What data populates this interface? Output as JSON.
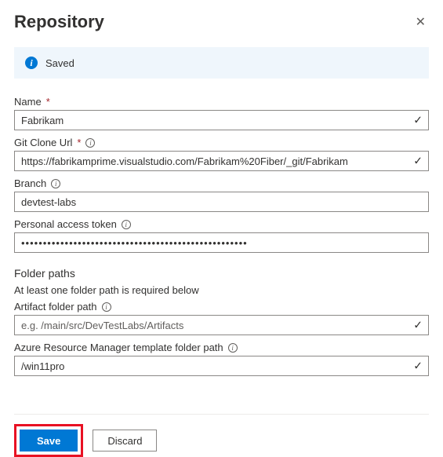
{
  "header": {
    "title": "Repository"
  },
  "status": {
    "text": "Saved"
  },
  "fields": {
    "name": {
      "label": "Name",
      "value": "Fabrikam"
    },
    "gitCloneUrl": {
      "label": "Git Clone Url",
      "value": "https://fabrikamprime.visualstudio.com/Fabrikam%20Fiber/_git/Fabrikam"
    },
    "branch": {
      "label": "Branch",
      "value": "devtest-labs"
    },
    "pat": {
      "label": "Personal access token",
      "value": "••••••••••••••••••••••••••••••••••••••••••••••••••••"
    }
  },
  "folderPaths": {
    "title": "Folder paths",
    "subtitle": "At least one folder path is required below",
    "artifact": {
      "label": "Artifact folder path",
      "placeholder": "e.g. /main/src/DevTestLabs/Artifacts"
    },
    "arm": {
      "label": "Azure Resource Manager template folder path",
      "value": "/win11pro"
    }
  },
  "buttons": {
    "save": "Save",
    "discard": "Discard"
  }
}
